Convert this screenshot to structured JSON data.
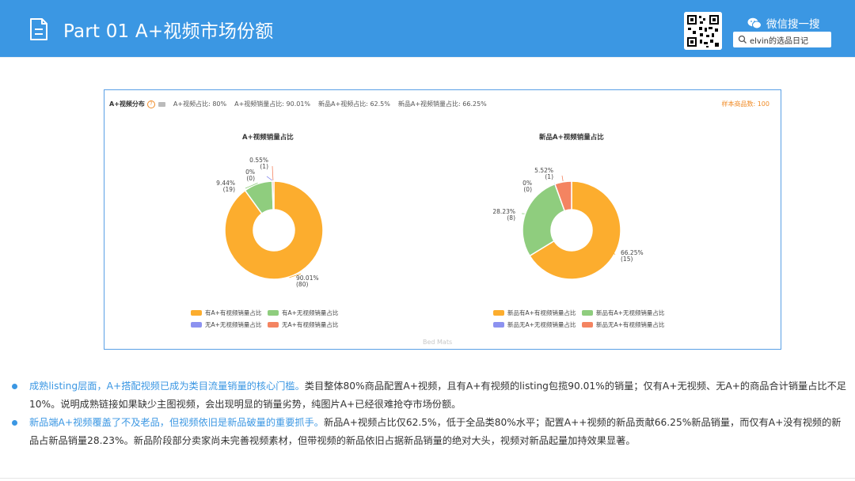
{
  "header": {
    "title": "Part 01  A+视频市场份额",
    "wechat_label": "微信搜一搜",
    "search_text": "elvin的选品日记",
    "bg_color": "#3b97e3"
  },
  "panel": {
    "label": "A+视频分布",
    "metrics": [
      "A+视频占比: 80%",
      "A+视频销量占比: 90.01%",
      "新品A+视频占比: 62.5%",
      "新品A+视频销量占比: 66.25%"
    ],
    "sample_count": "样本商品数: 100",
    "watermark": "Bed Mats"
  },
  "chart_data": [
    {
      "type": "pie",
      "title": "A+视频销量占比",
      "series": [
        {
          "name": "有A+有视频销量占比",
          "value": 90.01,
          "count": 80,
          "label": "90.01%",
          "count_label": "(80)",
          "color": "#fcad2e"
        },
        {
          "name": "有A+无视频销量占比",
          "value": 9.44,
          "count": 19,
          "label": "9.44%",
          "count_label": "(19)",
          "color": "#8fcd7e"
        },
        {
          "name": "无A+无视频销量占比",
          "value": 0,
          "count": 0,
          "label": "0%",
          "count_label": "(0)",
          "color": "#8c92f0"
        },
        {
          "name": "无A+有视频销量占比",
          "value": 0.55,
          "count": 1,
          "label": "0.55%",
          "count_label": "(1)",
          "color": "#f48461"
        }
      ]
    },
    {
      "type": "pie",
      "title": "新品A+视频销量占比",
      "series": [
        {
          "name": "新品有A+有视频销量占比",
          "value": 66.25,
          "count": 15,
          "label": "66.25%",
          "count_label": "(15)",
          "color": "#fcad2e"
        },
        {
          "name": "新品有A+无视频销量占比",
          "value": 28.23,
          "count": 8,
          "label": "28.23%",
          "count_label": "(8)",
          "color": "#8fcd7e"
        },
        {
          "name": "新品无A+无视频销量占比",
          "value": 0,
          "count": 0,
          "label": "0%",
          "count_label": "(0)",
          "color": "#8c92f0"
        },
        {
          "name": "新品无A+有视频销量占比",
          "value": 5.52,
          "count": 1,
          "label": "5.52%",
          "count_label": "(1)",
          "color": "#f48461"
        }
      ]
    }
  ],
  "bullets": [
    {
      "highlight": "成熟listing层面，A+搭配视频已成为类目流量销量的核心门槛。",
      "text": "类目整体80%商品配置A+视频，且有A+有视频的listing包揽90.01%的销量；仅有A+无视频、无A+的商品合计销量占比不足10%。说明成熟链接如果缺少主图视频，会出现明显的销量劣势，纯图片A+已经很难抢夺市场份额。"
    },
    {
      "highlight": "新品端A+视频覆盖了不及老品，但视频依旧是新品破量的重要抓手。",
      "text": "新品A+视频占比仅62.5%，低于全品类80%水平；配置A++视频的新品贡献66.25%新品销量，而仅有A+没有视频的新品占新品销量28.23%。新品阶段部分卖家尚未完善视频素材，但带视频的新品依旧占据新品销量的绝对大头，视频对新品起量加持效果显著。"
    }
  ]
}
